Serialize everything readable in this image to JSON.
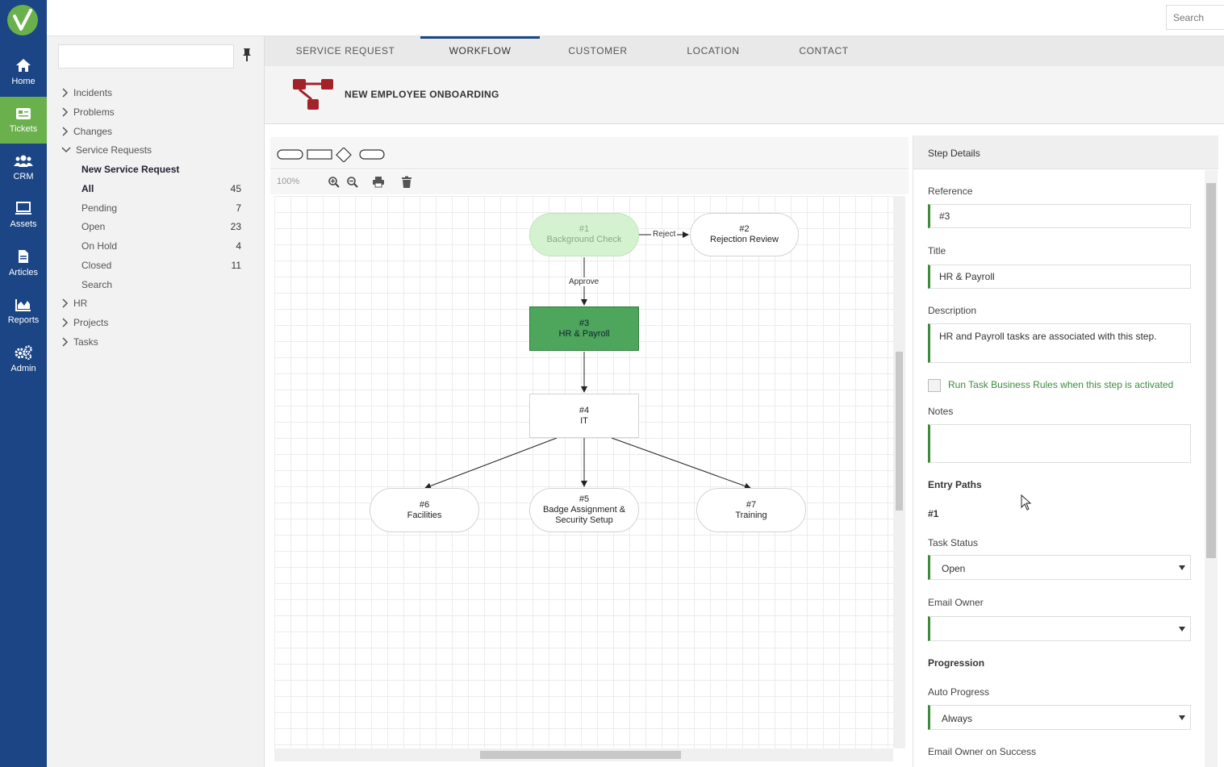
{
  "rail": {
    "items": [
      {
        "label": "Home",
        "icon": "home-icon"
      },
      {
        "label": "Tickets",
        "icon": "ticket-icon"
      },
      {
        "label": "CRM",
        "icon": "users-icon"
      },
      {
        "label": "Assets",
        "icon": "monitor-icon"
      },
      {
        "label": "Articles",
        "icon": "document-icon"
      },
      {
        "label": "Reports",
        "icon": "area-chart-icon"
      },
      {
        "label": "Admin",
        "icon": "gears-icon"
      }
    ],
    "active": "Tickets"
  },
  "topbar": {
    "search_placeholder": "Search"
  },
  "tree": {
    "search_value": "",
    "items": [
      {
        "label": "Incidents"
      },
      {
        "label": "Problems"
      },
      {
        "label": "Changes"
      },
      {
        "label": "Service Requests"
      },
      {
        "label": "New Service Request"
      },
      {
        "label": "All",
        "count": "45"
      },
      {
        "label": "Pending",
        "count": "7"
      },
      {
        "label": "Open",
        "count": "23"
      },
      {
        "label": "On Hold",
        "count": "4"
      },
      {
        "label": "Closed",
        "count": "11"
      },
      {
        "label": "Search"
      },
      {
        "label": "HR"
      },
      {
        "label": "Projects"
      },
      {
        "label": "Tasks"
      }
    ]
  },
  "tabs": [
    {
      "label": "SERVICE REQUEST"
    },
    {
      "label": "WORKFLOW"
    },
    {
      "label": "CUSTOMER"
    },
    {
      "label": "LOCATION"
    },
    {
      "label": "CONTACT"
    }
  ],
  "active_tab": "WORKFLOW",
  "workflow": {
    "title": "NEW EMPLOYEE ONBOARDING",
    "zoom": "100%",
    "nodes": [
      {
        "id": "#1",
        "label": "Background Check",
        "state": "done"
      },
      {
        "id": "#2",
        "label": "Rejection Review",
        "state": "pending"
      },
      {
        "id": "#3",
        "label": "HR & Payroll",
        "state": "current"
      },
      {
        "id": "#4",
        "label": "IT",
        "state": "pending"
      },
      {
        "id": "#5",
        "label": "Badge Assignment &",
        "label2": "Security Setup",
        "state": "pending"
      },
      {
        "id": "#6",
        "label": "Facilities",
        "state": "pending"
      },
      {
        "id": "#7",
        "label": "Training",
        "state": "pending"
      }
    ],
    "edges": [
      {
        "from": "#1",
        "to": "#2",
        "label": "Reject"
      },
      {
        "from": "#1",
        "to": "#3",
        "label": "Approve"
      },
      {
        "from": "#3",
        "to": "#4",
        "label": ""
      },
      {
        "from": "#4",
        "to": "#5",
        "label": ""
      },
      {
        "from": "#4",
        "to": "#6",
        "label": ""
      },
      {
        "from": "#4",
        "to": "#7",
        "label": ""
      }
    ]
  },
  "details": {
    "heading": "Step Details",
    "reference_label": "Reference",
    "reference_value": "#3",
    "title_label": "Title",
    "title_value": "HR & Payroll",
    "description_label": "Description",
    "description_value": "HR and Payroll tasks are associated with this step.",
    "run_rules_label": "Run Task Business Rules when this step is activated",
    "notes_label": "Notes",
    "notes_value": "",
    "entry_paths_label": "Entry Paths",
    "entry_paths_value": "#1",
    "task_status_label": "Task Status",
    "task_status_value": "Open",
    "email_owner_label": "Email Owner",
    "email_owner_value": "",
    "progression_label": "Progression",
    "auto_progress_label": "Auto Progress",
    "auto_progress_value": "Always",
    "email_owner_success_label": "Email Owner on Success"
  },
  "colors": {
    "rail": "#1b4585",
    "accent_green": "#6ab04c",
    "current_step": "#4ea55c",
    "done_step": "#d4f2d0"
  }
}
